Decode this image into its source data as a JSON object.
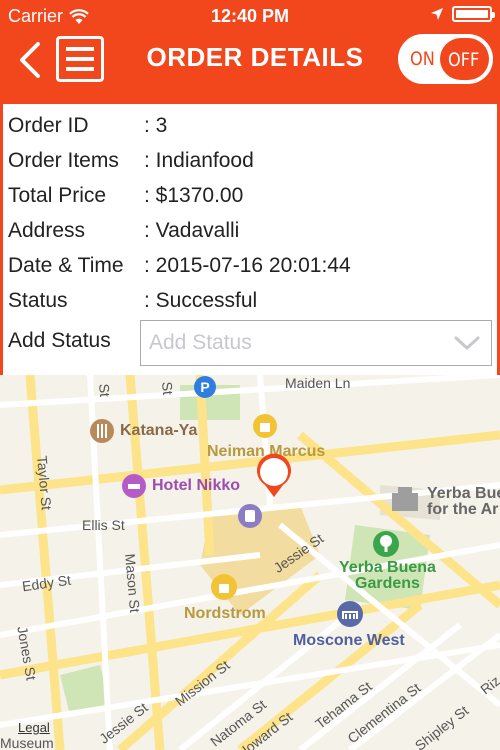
{
  "status_bar": {
    "carrier": "Carrier",
    "time": "12:40 PM"
  },
  "nav": {
    "title": "ORDER DETAILS",
    "toggle_on": "ON",
    "toggle_off": "OFF"
  },
  "details": {
    "rows": [
      {
        "label": "Order ID",
        "value": "3"
      },
      {
        "label": "Order Items",
        "value": "Indianfood"
      },
      {
        "label": "Total Price",
        "value": "$1370.00"
      },
      {
        "label": "Address",
        "value": "Vadavalli"
      },
      {
        "label": "Date & Time",
        "value": "2015-07-16 20:01:44"
      },
      {
        "label": "Status",
        "value": "Successful"
      }
    ],
    "add_status_label": "Add Status",
    "add_status_placeholder": "Add Status"
  },
  "map": {
    "streets": {
      "maiden_ln": "Maiden Ln",
      "taylor_st": "Taylor St",
      "ellis_st": "Ellis St",
      "eddy_st": "Eddy St",
      "mason_st": "Mason St",
      "jones_st": "Jones St",
      "jessie_st": "Jessie St",
      "jessie_st_2": "Jessie St",
      "mission_st": "Mission St",
      "natoma_st": "Natoma St",
      "howard_st": "Howard St",
      "tehama_st": "Tehama St",
      "clementina_st": "Clementina St",
      "shipley_st": "Shipley St",
      "st_1": "St",
      "st_2": "St",
      "riz": "Riz",
      "museum": "Museum"
    },
    "pois": {
      "katana_ya": "Katana-Ya",
      "neiman_marcus": "Neiman Marcus",
      "hotel_nikko": "Hotel Nikko",
      "yerba_buena_1": "Yerba Bue",
      "yerba_buena_2": "for the Ar",
      "yerba_buena_gardens_1": "Yerba Buena",
      "yerba_buena_gardens_2": "Gardens",
      "nordstrom": "Nordstrom",
      "moscone_west": "Moscone West"
    },
    "legal": "Legal"
  },
  "colors": {
    "accent": "#f2471d"
  }
}
